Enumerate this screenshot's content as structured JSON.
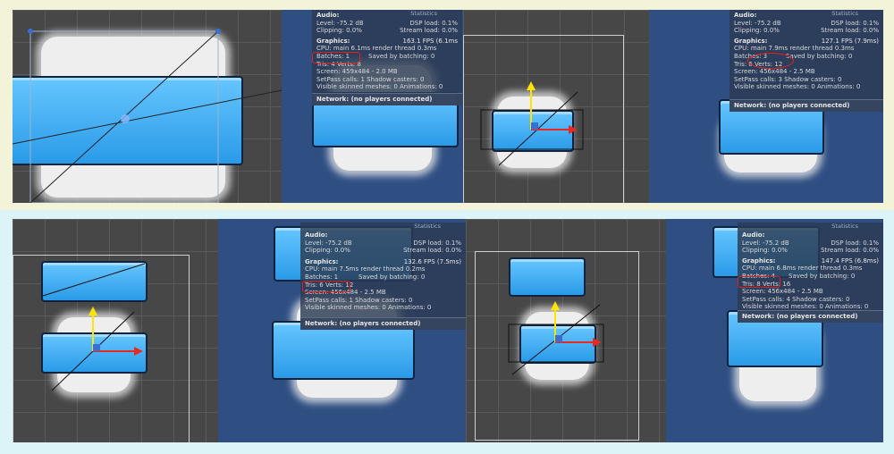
{
  "stats_top_left": {
    "title": "Statistics",
    "audio_header": "Audio:",
    "level": "Level: -75.2 dB",
    "dsp": "DSP load: 0.1%",
    "clipping": "Clipping: 0.0%",
    "stream": "Stream load: 0.0%",
    "graphics_header": "Graphics:",
    "fps": "163.1 FPS (6.1ms",
    "cpu": "CPU: main 6.1ms render thread 0.3ms",
    "batches": "Batches: 1",
    "saved": "Saved by batching: 0",
    "tris": "Tris: 4 Verts: 8",
    "screen": "Screen: 459x484 - 2.0 MB",
    "setpass": "SetPass calls: 1 Shadow casters: 0",
    "visible": "Visible skinned meshes: 0 Animations: 0",
    "network": "Network: (no players connected)"
  },
  "stats_top_right": {
    "title": "Statistics",
    "audio_header": "Audio:",
    "level": "Level: -75.2 dB",
    "dsp": "DSP load: 0.1%",
    "clipping": "Clipping: 0.0%",
    "stream": "Stream load: 0.0%",
    "graphics_header": "Graphics:",
    "fps": "127.1 FPS (7.9ms)",
    "cpu": "CPU: main 7.9ms render thread 0.3ms",
    "batches": "Batches: 3",
    "saved": "Saved by batching: 0",
    "tris": "Tris: 6 Verts: 12",
    "screen": "Screen: 456x484 - 2.5 MB",
    "setpass": "SetPass calls: 3 Shadow casters: 0",
    "visible": "Visible skinned meshes: 0 Animations: 0",
    "network": "Network: (no players connected)"
  },
  "stats_bottom_left": {
    "title": "Statistics",
    "audio_header": "Audio:",
    "level": "Level: -75.2 dB",
    "dsp": "DSP load: 0.1%",
    "clipping": "Clipping: 0.0%",
    "stream": "Stream load: 0.0%",
    "graphics_header": "Graphics:",
    "fps": "132.6 FPS (7.5ms)",
    "cpu": "CPU: main 7.5ms render thread 0.2ms",
    "batches": "Batches: 1",
    "saved": "Saved by batching: 0",
    "tris": "Tris: 6 Verts: 12",
    "screen": "Screen: 456x484 - 2.5 MB",
    "setpass": "SetPass calls: 1 Shadow casters: 0",
    "visible": "Visible skinned meshes: 0 Animations: 0",
    "network": "Network: (no players connected)"
  },
  "stats_bottom_right": {
    "title": "Statistics",
    "audio_header": "Audio:",
    "level": "Level: -75.2 dB",
    "dsp": "DSP load: 0.1%",
    "clipping": "Clipping: 0.0%",
    "stream": "Stream load: 0.0%",
    "graphics_header": "Graphics:",
    "fps": "147.4 FPS (6.8ms)",
    "cpu": "CPU: main 6.8ms render thread 0.3ms",
    "batches": "Batches: 4",
    "saved": "Saved by batching: 0",
    "tris": "Tris: 8 Verts: 16",
    "screen": "Screen: 456x484 - 2.5 MB",
    "setpass": "SetPass calls: 4 Shadow casters: 0",
    "visible": "Visible skinned meshes: 0 Animations: 0",
    "network": "Network: (no players connected)"
  },
  "colors": {
    "highlight": "#e0221c",
    "scene_bg": "#474747",
    "game_bg": "#2f4f83",
    "sprite_blue": "#3aa8f2",
    "top_row_bg": "#f3f3d9",
    "bottom_row_bg": "#dcf4f8"
  }
}
